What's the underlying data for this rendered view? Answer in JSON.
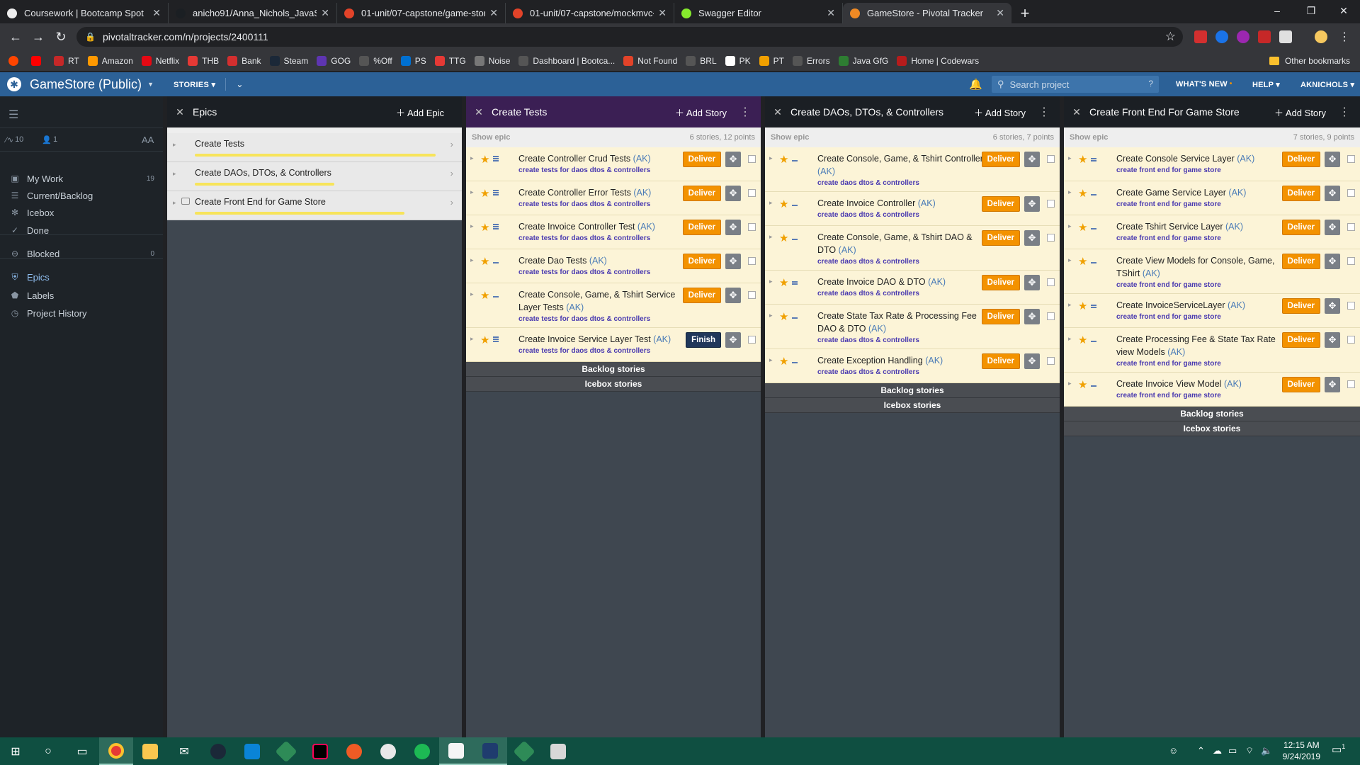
{
  "browser": {
    "tabs": [
      {
        "title": "Coursework | Bootcamp Spot",
        "color": "#eeeeee"
      },
      {
        "title": "anicho91/Anna_Nichols_JavaS1",
        "color": "#1b1f23"
      },
      {
        "title": "01-unit/07-capstone/game-store",
        "color": "#e24329"
      },
      {
        "title": "01-unit/07-capstone/mockmvc-e",
        "color": "#e24329"
      },
      {
        "title": "Swagger Editor",
        "color": "#85ea2d"
      },
      {
        "title": "GameStore - Pivotal Tracker",
        "color": "#f08a24",
        "active": true
      }
    ],
    "new_tab": "+",
    "window_controls": {
      "minimize": "–",
      "restore": "❐",
      "close": "✕"
    },
    "url": "pivotaltracker.com/n/projects/2400111",
    "bookmarks": [
      "RT",
      "Amazon",
      "Netflix",
      "THB",
      "Bank",
      "Steam",
      "GOG",
      "%Off",
      "PS",
      "TTG",
      "Noise",
      "Dashboard | Bootca...",
      "Not Found",
      "BRL",
      "PK",
      "PT",
      "Errors",
      "Java GfG",
      "Home | Codewars"
    ],
    "other_bookmarks": "Other bookmarks"
  },
  "header": {
    "project_name": "GameStore (Public)",
    "stories_menu": "STORIES",
    "search_placeholder": "Search project",
    "search_help": "?",
    "whats_new": "WHAT'S NEW",
    "help": "HELP",
    "user": "AKNICHOLS"
  },
  "sidebar": {
    "velocity": "10",
    "members": "1",
    "font_toggle": "AA",
    "items": [
      {
        "label": "My Work",
        "count": "19",
        "icon": "person-icon"
      },
      {
        "label": "Current/Backlog",
        "count": "",
        "icon": "list-icon"
      },
      {
        "label": "Icebox",
        "count": "",
        "icon": "snowflake-icon"
      },
      {
        "label": "Done",
        "count": "",
        "icon": "check-icon"
      },
      {
        "label": "Blocked",
        "count": "0",
        "icon": "blocked-icon"
      },
      {
        "label": "Epics",
        "count": "",
        "icon": "shield-icon",
        "active": true
      },
      {
        "label": "Labels",
        "count": "",
        "icon": "tag-icon"
      },
      {
        "label": "Project History",
        "count": "",
        "icon": "history-icon"
      }
    ]
  },
  "epics_panel": {
    "title": "Epics",
    "add_label": "Add Epic",
    "epics": [
      {
        "name": "Create Tests",
        "progress": 1.0
      },
      {
        "name": "Create DAOs, DTOs, & Controllers",
        "progress": 0.58
      },
      {
        "name": "Create Front End for Game Store",
        "progress": 0.87
      }
    ]
  },
  "columns": [
    {
      "title": "Create Tests",
      "add_label": "Add Story",
      "show_epic": "Show epic",
      "summary": "6 stories, 12 points",
      "stories": [
        {
          "name": "Create Controller Crud Tests",
          "owner": "(AK)",
          "label": "create tests for daos dtos & controllers",
          "button": "Deliver",
          "points": 3
        },
        {
          "name": "Create Controller Error Tests",
          "owner": "(AK)",
          "label": "create tests for daos dtos & controllers",
          "button": "Deliver",
          "points": 3
        },
        {
          "name": "Create Invoice Controller Test",
          "owner": "(AK)",
          "label": "create tests for daos dtos & controllers",
          "button": "Deliver",
          "points": 3
        },
        {
          "name": "Create Dao Tests",
          "owner": "(AK)",
          "label": "create tests for daos dtos & controllers",
          "button": "Deliver",
          "points": 1
        },
        {
          "name": "Create Console, Game, & Tshirt Service Layer Tests",
          "owner": "(AK)",
          "label": "create tests for daos dtos & controllers",
          "button": "Deliver",
          "points": 1
        },
        {
          "name": "Create Invoice Service Layer Test",
          "owner": "(AK)",
          "label": "create tests for daos dtos & controllers",
          "button": "Finish",
          "points": 3
        }
      ],
      "backlog": "Backlog stories",
      "icebox": "Icebox stories"
    },
    {
      "title": "Create DAOs, DTOs, & Controllers",
      "add_label": "Add Story",
      "show_epic": "Show epic",
      "summary": "6 stories, 7 points",
      "stories": [
        {
          "name": "Create Console, Game, & Tshirt Controllers",
          "owner": "(AK)",
          "label": "create daos dtos & controllers",
          "button": "Deliver",
          "points": 1
        },
        {
          "name": "Create Invoice Controller",
          "owner": "(AK)",
          "label": "create daos dtos & controllers",
          "button": "Deliver",
          "points": 1
        },
        {
          "name": "Create Console, Game, & Tshirt DAO & DTO",
          "owner": "(AK)",
          "label": "create daos dtos & controllers",
          "button": "Deliver",
          "points": 1
        },
        {
          "name": "Create Invoice DAO & DTO",
          "owner": "(AK)",
          "label": "create daos dtos & controllers",
          "button": "Deliver",
          "points": 2
        },
        {
          "name": "Create State Tax Rate & Processing Fee DAO & DTO",
          "owner": "(AK)",
          "label": "create daos dtos & controllers",
          "button": "Deliver",
          "points": 1
        },
        {
          "name": "Create Exception Handling",
          "owner": "(AK)",
          "label": "create daos dtos & controllers",
          "button": "Deliver",
          "points": 1
        }
      ],
      "backlog": "Backlog stories",
      "icebox": "Icebox stories"
    },
    {
      "title": "Create Front End For Game Store",
      "add_label": "Add Story",
      "show_epic": "Show epic",
      "summary": "7 stories, 9 points",
      "stories": [
        {
          "name": "Create Console Service Layer",
          "owner": "(AK)",
          "label": "create front end for game store",
          "button": "Deliver",
          "points": 2
        },
        {
          "name": "Create Game Service Layer",
          "owner": "(AK)",
          "label": "create front end for game store",
          "button": "Deliver",
          "points": 1
        },
        {
          "name": "Create Tshirt Service Layer",
          "owner": "(AK)",
          "label": "create front end for game store",
          "button": "Deliver",
          "points": 1
        },
        {
          "name": "Create View Models for Console, Game, TShirt",
          "owner": "(AK)",
          "label": "create front end for game store",
          "button": "Deliver",
          "points": 1
        },
        {
          "name": "Create InvoiceServiceLayer",
          "owner": "(AK)",
          "label": "create front end for game store",
          "button": "Deliver",
          "points": 2
        },
        {
          "name": "Create Processing Fee & State Tax Rate view Models",
          "owner": "(AK)",
          "label": "create front end for game store",
          "button": "Deliver",
          "points": 1
        },
        {
          "name": "Create Invoice View Model",
          "owner": "(AK)",
          "label": "create front end for game store",
          "button": "Deliver",
          "points": 1
        }
      ],
      "backlog": "Backlog stories",
      "icebox": "Icebox stories"
    }
  ],
  "taskbar": {
    "time": "12:15 AM",
    "date": "9/24/2019",
    "notifications": "1"
  },
  "colors": {
    "pt_header": "#2c6197",
    "deliver": "#f39200",
    "finish": "#20375a",
    "story_bg": "#fcf4d7"
  }
}
